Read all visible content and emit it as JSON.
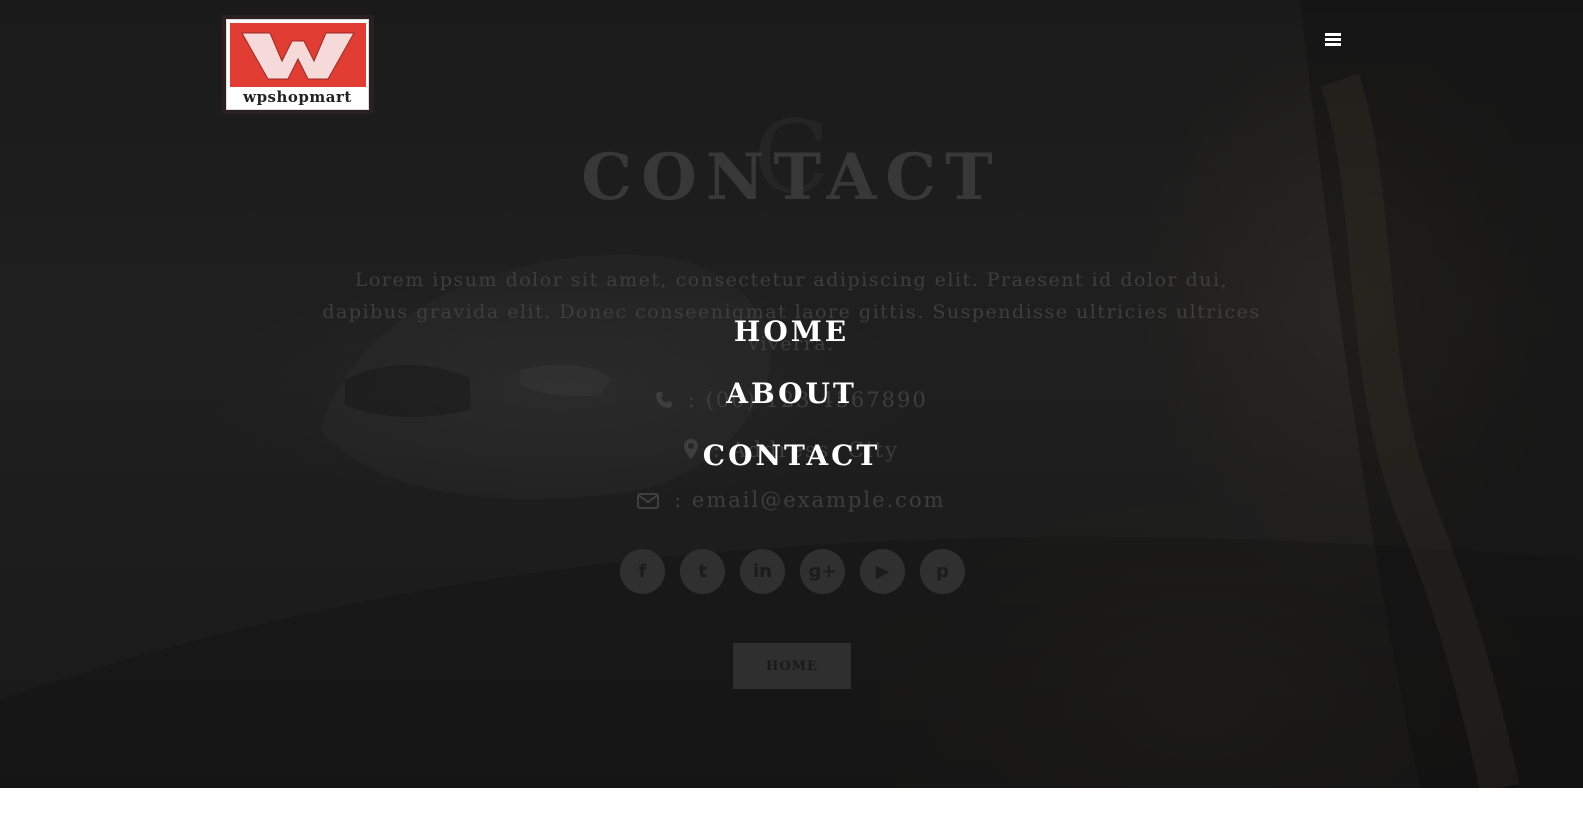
{
  "brand": {
    "logo_text": "wpshopmart",
    "logo_letter": "W",
    "logo_red": "#e23d33"
  },
  "header": {
    "menu_icon": "hamburger-menu-icon"
  },
  "hero": {
    "watermark": "C",
    "title": "CONTACT",
    "intro": "Lorem ipsum dolor sit amet, consectetur adipiscing elit. Praesent id dolor dui, dapibus gravida elit. Donec conseenigmat laore gittis. Suspendisse ultricies ultrices viverra."
  },
  "contact": {
    "phone": ": (00) 123 4567890",
    "address": ": Address, City",
    "email": ": email@example.com"
  },
  "social": [
    {
      "name": "facebook-icon",
      "glyph": "f"
    },
    {
      "name": "twitter-icon",
      "glyph": "t"
    },
    {
      "name": "linkedin-icon",
      "glyph": "in"
    },
    {
      "name": "google-plus-icon",
      "glyph": "g+"
    },
    {
      "name": "youtube-icon",
      "glyph": "▶"
    },
    {
      "name": "pinterest-icon",
      "glyph": "p"
    }
  ],
  "cta": {
    "home_label": "HOME"
  },
  "nav": {
    "items": [
      "HOME",
      "ABOUT",
      "CONTACT"
    ]
  }
}
